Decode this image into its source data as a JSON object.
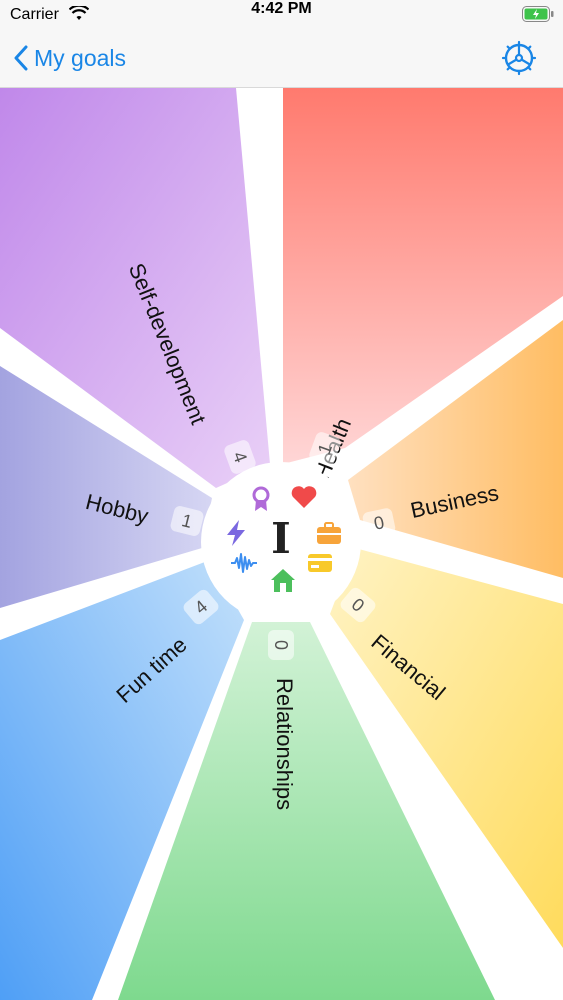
{
  "status_bar": {
    "carrier": "Carrier",
    "time": "4:42 PM"
  },
  "nav": {
    "back_label": "My goals",
    "back_icon": "chevron-left-icon",
    "settings_icon": "gear-icon"
  },
  "accent_color": "#1a86e6",
  "wheel": {
    "center_letter": "I",
    "segments": [
      {
        "key": "health",
        "label": "Health",
        "count": "1",
        "icon": "heart-icon",
        "color": "#ff7a6e"
      },
      {
        "key": "business",
        "label": "Business",
        "count": "0",
        "icon": "briefcase-icon",
        "color": "#ffbd63"
      },
      {
        "key": "financial",
        "label": "Financial",
        "count": "0",
        "icon": "card-icon",
        "color": "#ffdb5c"
      },
      {
        "key": "relationships",
        "label": "Relationships",
        "count": "0",
        "icon": "house-icon",
        "color": "#7ed98e"
      },
      {
        "key": "fun_time",
        "label": "Fun time",
        "count": "4",
        "icon": "soundwave-icon",
        "color": "#5aa6f6"
      },
      {
        "key": "hobby",
        "label": "Hobby",
        "count": "1",
        "icon": "lightning-icon",
        "color": "#a3a3e0"
      },
      {
        "key": "self_development",
        "label": "Self-development",
        "count": "4",
        "icon": "award-icon",
        "color": "#c48ee8"
      }
    ]
  }
}
